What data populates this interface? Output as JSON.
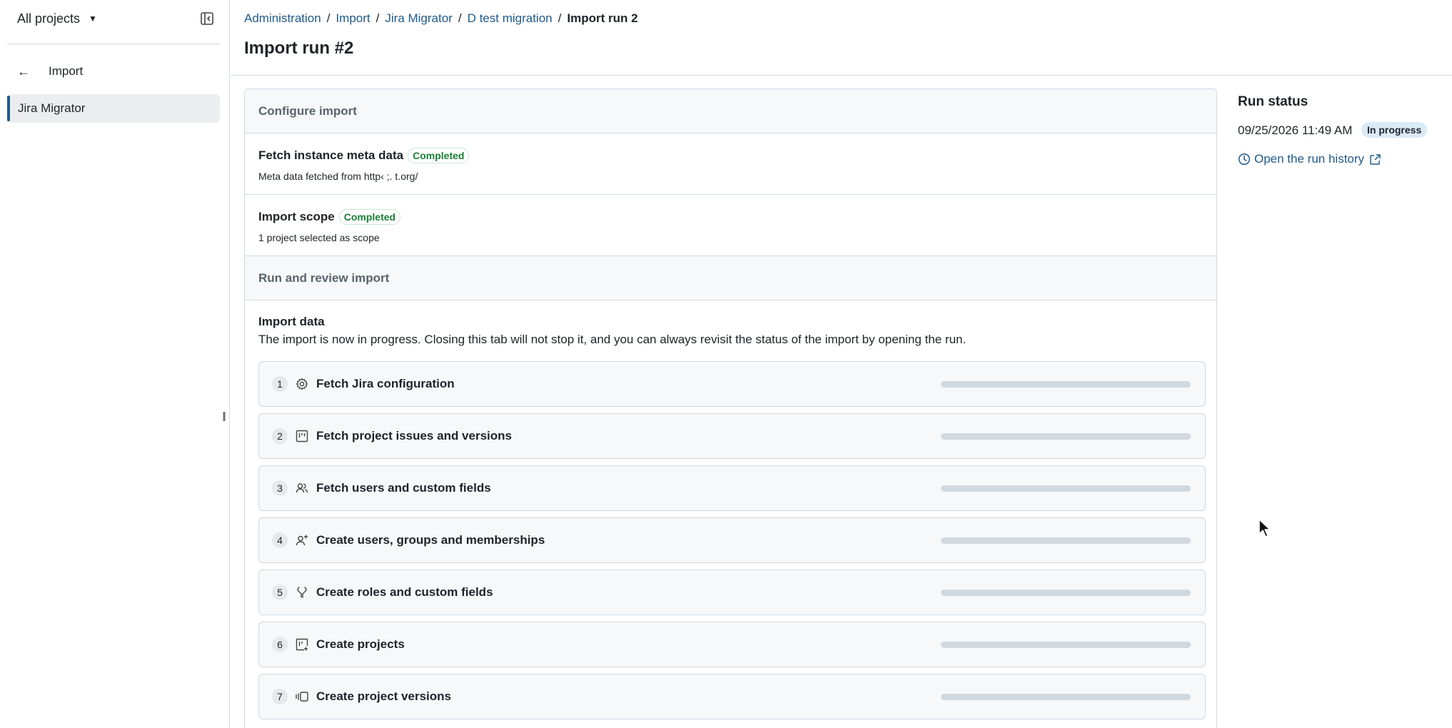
{
  "sidebar": {
    "project_switcher": "All projects",
    "back_label": "Import",
    "items": [
      {
        "label": "Jira Migrator"
      }
    ]
  },
  "breadcrumb": {
    "items": [
      "Administration",
      "Import",
      "Jira Migrator",
      "D test migration"
    ],
    "current": "Import run 2"
  },
  "page": {
    "title": "Import run #2"
  },
  "configure": {
    "heading": "Configure import",
    "steps": [
      {
        "title": "Fetch instance meta data",
        "status": "Completed",
        "subtitle": "Meta data fetched from http‹                     ;.  t.org/"
      },
      {
        "title": "Import scope",
        "status": "Completed",
        "subtitle": "1 project selected as scope"
      }
    ]
  },
  "run_review": {
    "heading": "Run and review import",
    "import_title": "Import data",
    "import_desc": "The import is now in progress. Closing this tab will not stop it, and you can always revisit the status of the import by opening the run.",
    "tasks": [
      {
        "number": "1",
        "icon": "gear-icon",
        "label": "Fetch Jira configuration",
        "progress": 0
      },
      {
        "number": "2",
        "icon": "project-board-icon",
        "label": "Fetch project issues and versions",
        "progress": 0
      },
      {
        "number": "3",
        "icon": "people-icon",
        "label": "Fetch users and custom fields",
        "progress": 0
      },
      {
        "number": "4",
        "icon": "person-add-icon",
        "label": "Create users, groups and memberships",
        "progress": 0
      },
      {
        "number": "5",
        "icon": "tools-icon",
        "label": "Create roles and custom fields",
        "progress": 0
      },
      {
        "number": "6",
        "icon": "project-add-icon",
        "label": "Create projects",
        "progress": 0
      },
      {
        "number": "7",
        "icon": "versions-icon",
        "label": "Create project versions",
        "progress": 0
      }
    ]
  },
  "run_status": {
    "title": "Run status",
    "date": "09/25/2026 11:49 AM",
    "badge": "In progress",
    "history_link": "Open the run history"
  },
  "colors": {
    "accent": "#1f5a8a",
    "success": "#1a7f37",
    "progress_badge_bg": "#dbeaf7"
  }
}
